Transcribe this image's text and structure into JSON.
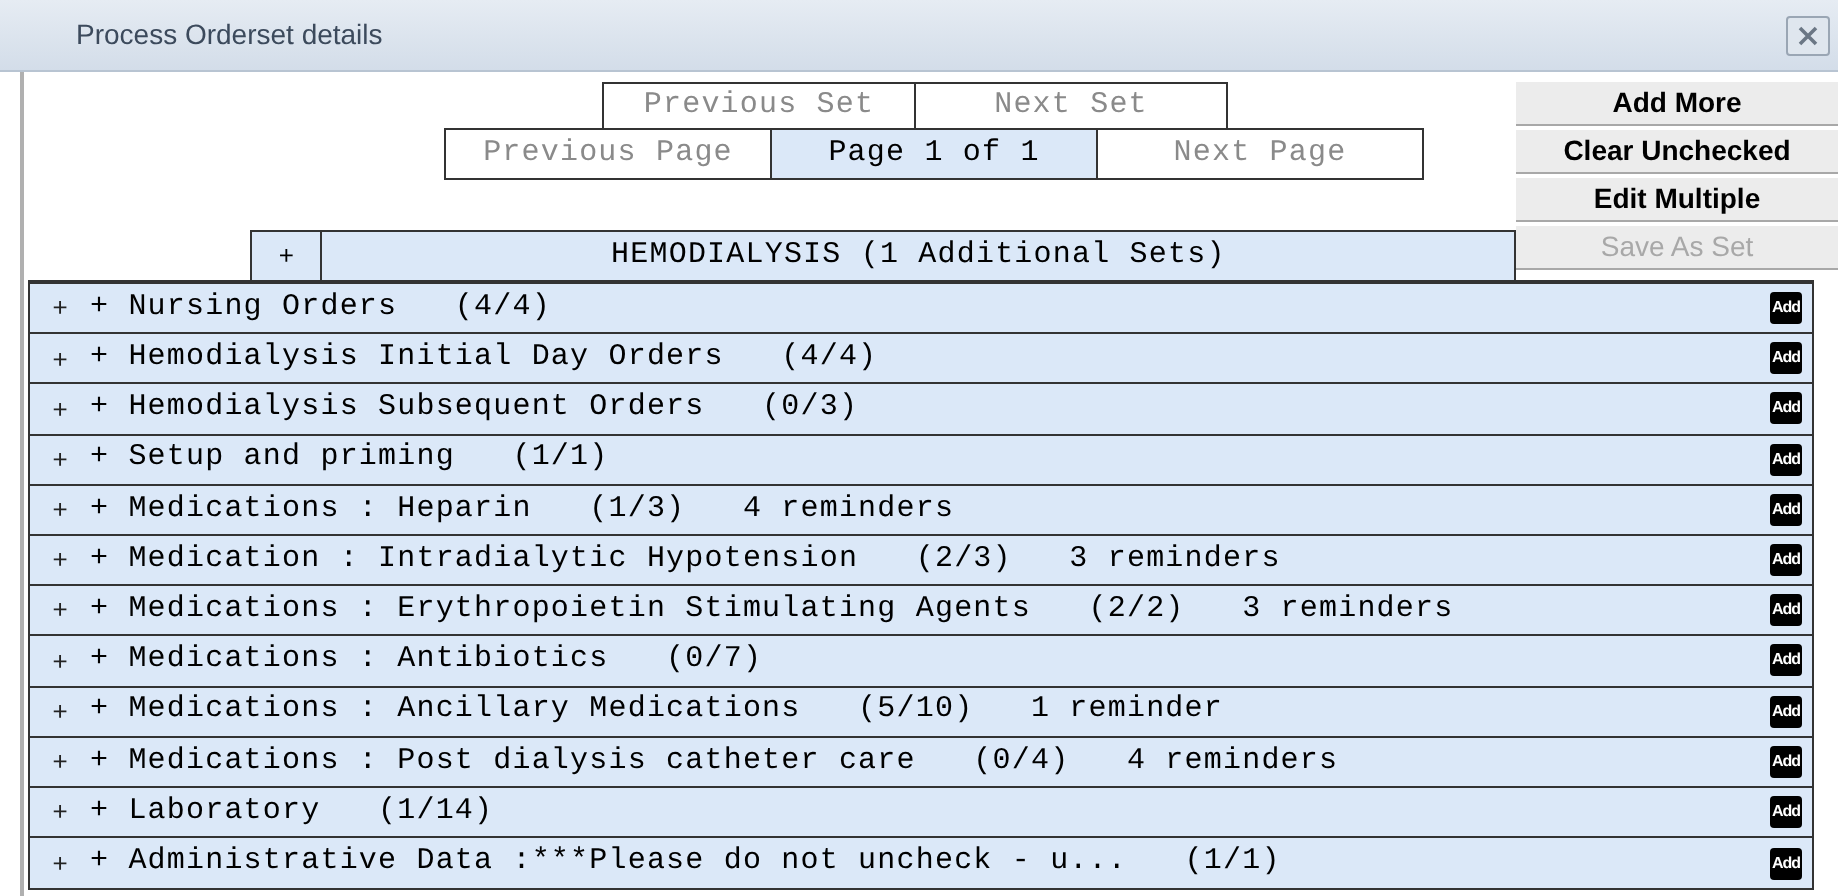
{
  "window": {
    "title": "Process Orderset details"
  },
  "set_nav": [
    {
      "label": "Previous Set",
      "disabled": true
    },
    {
      "label": "Next Set",
      "disabled": true
    }
  ],
  "page_nav": [
    {
      "label": "Previous Page",
      "kind": "button",
      "disabled": true
    },
    {
      "label": "Page 1 of 1",
      "kind": "indicator",
      "disabled": false
    },
    {
      "label": "Next Page",
      "kind": "button",
      "disabled": true
    }
  ],
  "actions": [
    {
      "label": "Add More",
      "disabled": false
    },
    {
      "label": "Clear Unchecked",
      "disabled": false
    },
    {
      "label": "Edit Multiple",
      "disabled": false
    },
    {
      "label": "Save As Set",
      "disabled": true
    }
  ],
  "group": {
    "expander": "+",
    "title": "HEMODIALYSIS (1 Additional Sets)"
  },
  "sections": [
    {
      "expander": "+",
      "label": "+ Nursing Orders   (4/4)",
      "add": "Add"
    },
    {
      "expander": "+",
      "label": "+ Hemodialysis Initial Day Orders   (4/4)",
      "add": "Add"
    },
    {
      "expander": "+",
      "label": "+ Hemodialysis Subsequent Orders   (0/3)",
      "add": "Add"
    },
    {
      "expander": "+",
      "label": "+ Setup and priming   (1/1)",
      "add": "Add"
    },
    {
      "expander": "+",
      "label": "+ Medications : Heparin   (1/3)   4 reminders",
      "add": "Add"
    },
    {
      "expander": "+",
      "label": "+ Medication : Intradialytic Hypotension   (2/3)   3 reminders",
      "add": "Add"
    },
    {
      "expander": "+",
      "label": "+ Medications : Erythropoietin Stimulating Agents   (2/2)   3 reminders",
      "add": "Add"
    },
    {
      "expander": "+",
      "label": "+ Medications : Antibiotics   (0/7)",
      "add": "Add"
    },
    {
      "expander": "+",
      "label": "+ Medications : Ancillary Medications   (5/10)   1 reminder",
      "add": "Add"
    },
    {
      "expander": "+",
      "label": "+ Medications : Post dialysis catheter care   (0/4)   4 reminders",
      "add": "Add"
    },
    {
      "expander": "+",
      "label": "+ Laboratory   (1/14)",
      "add": "Add"
    },
    {
      "expander": "+",
      "label": "+ Administrative Data :***Please do not uncheck - u...   (1/1)",
      "add": "Add"
    }
  ]
}
